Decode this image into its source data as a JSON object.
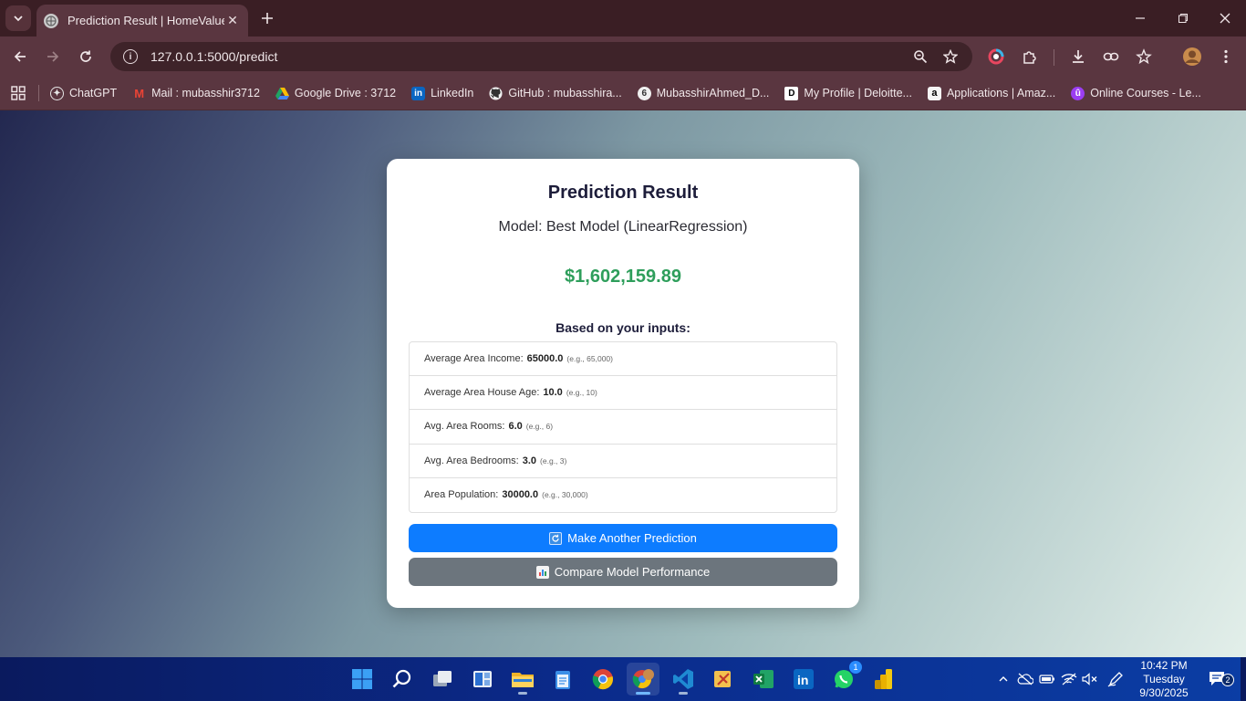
{
  "browser": {
    "tab_title": "Prediction Result | HomeValueA",
    "url": "127.0.0.1:5000/predict",
    "bookmarks": [
      {
        "label": "ChatGPT",
        "icon": "chatgpt-icon"
      },
      {
        "label": "Mail : mubasshir3712",
        "icon": "gmail-icon"
      },
      {
        "label": "Google Drive : 3712",
        "icon": "google-drive-icon"
      },
      {
        "label": "LinkedIn",
        "icon": "linkedin-icon"
      },
      {
        "label": "GitHub : mubasshira...",
        "icon": "github-icon"
      },
      {
        "label": "MubasshirAhmed_D...",
        "icon": "profile-icon"
      },
      {
        "label": "My Profile | Deloitte...",
        "icon": "deloitte-icon"
      },
      {
        "label": "Applications | Amaz...",
        "icon": "amazon-icon"
      },
      {
        "label": "Online Courses - Le...",
        "icon": "course-icon"
      }
    ]
  },
  "result": {
    "title": "Prediction Result",
    "model_line": "Model: Best Model (LinearRegression)",
    "price": "$1,602,159.89",
    "inputs_heading": "Based on your inputs:",
    "inputs": [
      {
        "label": "Average Area Income:",
        "value": "65000.0",
        "example": "(e.g., 65,000)"
      },
      {
        "label": "Average Area House Age:",
        "value": "10.0",
        "example": "(e.g., 10)"
      },
      {
        "label": "Avg. Area Rooms:",
        "value": "6.0",
        "example": "(e.g., 6)"
      },
      {
        "label": "Avg. Area Bedrooms:",
        "value": "3.0",
        "example": "(e.g., 3)"
      },
      {
        "label": "Area Population:",
        "value": "30000.0",
        "example": "(e.g., 30,000)"
      }
    ],
    "primary_button": "Make Another Prediction",
    "secondary_button": "Compare Model Performance"
  },
  "taskbar": {
    "clock_time": "10:42 PM",
    "clock_day": "Tuesday",
    "clock_date": "9/30/2025",
    "whatsapp_badge": "1",
    "notification_count": "2"
  }
}
